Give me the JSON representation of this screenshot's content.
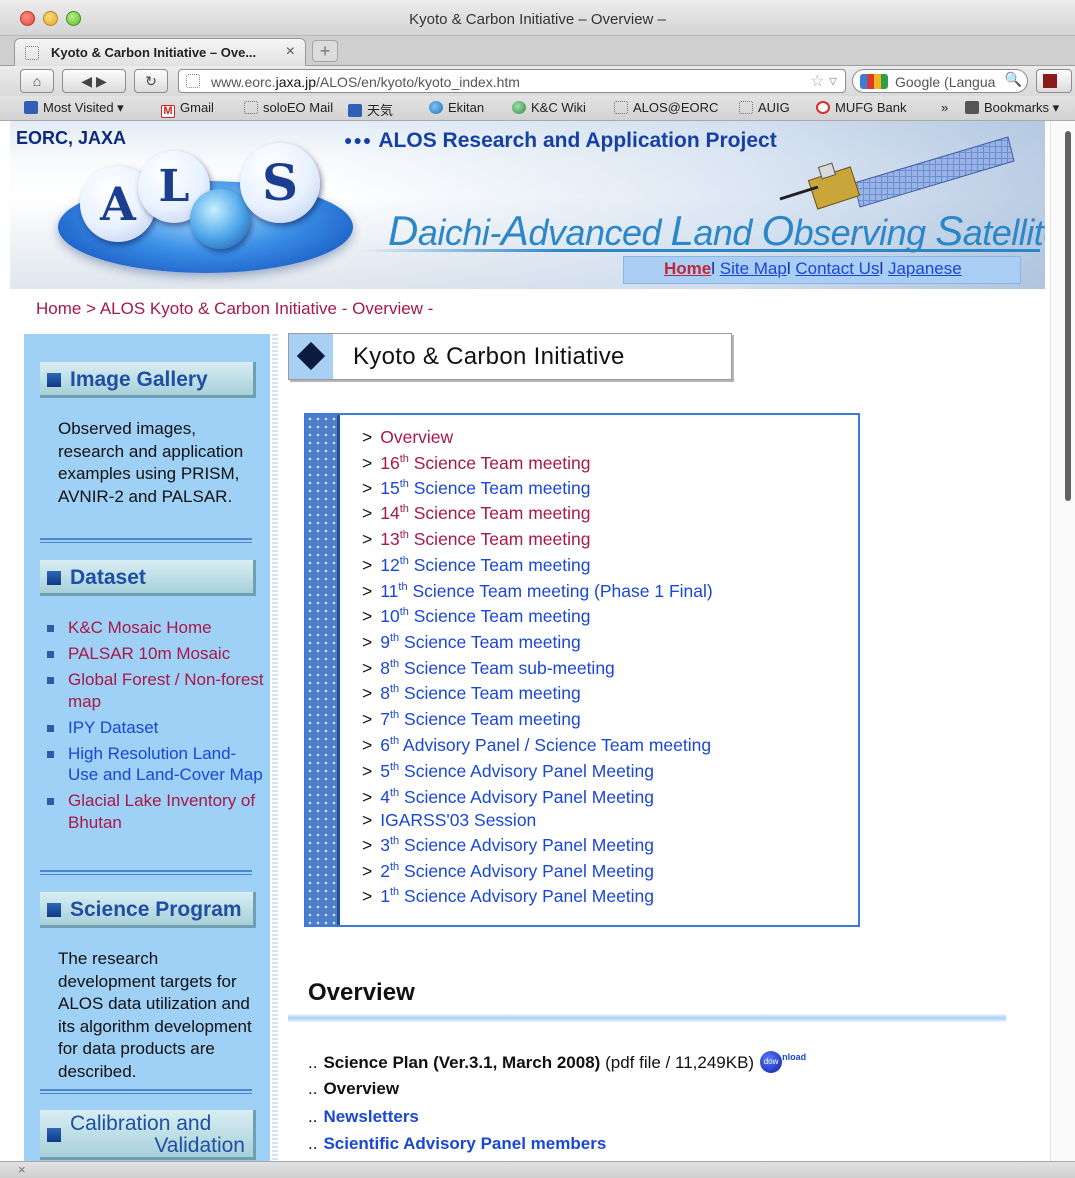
{
  "browser": {
    "window_title": "Kyoto & Carbon Initiative – Overview –",
    "tab_title": "Kyoto & Carbon Initiative – Ove...",
    "tab_close": "×",
    "new_tab": "+",
    "url_prefix": "www.eorc.",
    "url_domain": "jaxa.jp",
    "url_path": "/ALOS/en/kyoto/kyoto_index.htm",
    "search_placeholder": "Google (Langua",
    "bookmarks": [
      {
        "label": "Most Visited ▾",
        "icon": "most-visited-icon"
      },
      {
        "label": "Gmail",
        "icon": "gmail-icon"
      },
      {
        "label": "soloEO Mail",
        "icon": "page-icon"
      },
      {
        "label": "天気",
        "icon": "weather-icon"
      },
      {
        "label": "Ekitan",
        "icon": "globe-icon"
      },
      {
        "label": "K&C Wiki",
        "icon": "wiki-icon"
      },
      {
        "label": "ALOS@EORC",
        "icon": "page-icon"
      },
      {
        "label": "AUIG",
        "icon": "page-icon"
      },
      {
        "label": "MUFG Bank",
        "icon": "mufg-icon"
      },
      {
        "label": "»",
        "icon": "chevron-icon"
      },
      {
        "label": "Bookmarks ▾",
        "icon": "bookmarks-icon"
      }
    ]
  },
  "header": {
    "org": "EORC, JAXA",
    "logo_letters": [
      "A",
      "L",
      "S"
    ],
    "project_dots": "●●●",
    "project_title": "ALOS Research and Application Project",
    "tagline_parts": [
      "D",
      "aichi",
      "-",
      "A",
      "dvanced ",
      "L",
      "and ",
      "O",
      "bserving ",
      "S",
      "atellite"
    ],
    "nav": [
      {
        "label": "Home",
        "current": true
      },
      {
        "label": "Site Map",
        "current": false
      },
      {
        "label": "Contact Us",
        "current": false
      },
      {
        "label": "Japanese",
        "current": false
      }
    ],
    "nav_sep": "l"
  },
  "breadcrumb": {
    "home": "Home",
    "sep": ">",
    "current": "ALOS Kyoto & Carbon Initiative - Overview -"
  },
  "sidebar": {
    "image_gallery": {
      "title": "Image Gallery",
      "text": "Observed images, research and application examples using PRISM, AVNIR-2 and PALSAR."
    },
    "dataset": {
      "title": "Dataset",
      "items": [
        {
          "label": "K&C Mosaic Home",
          "visited": true
        },
        {
          "label": "PALSAR 10m Mosaic",
          "visited": true
        },
        {
          "label": "Global Forest / Non-forest map",
          "visited": true
        },
        {
          "label": "IPY Dataset",
          "visited": false
        },
        {
          "label": "High Resolution Land-Use and Land-Cover Map",
          "visited": false
        },
        {
          "label": "Glacial Lake Inventory of Bhutan",
          "visited": true
        }
      ]
    },
    "science_program": {
      "title": "Science Program",
      "text": "The research development targets for ALOS data utilization and its algorithm development for data products are described."
    },
    "calval": {
      "title_line1": "Calibration and",
      "title_line2": "Validation"
    }
  },
  "main": {
    "title": "Kyoto & Carbon Initiative",
    "meetings_sep": ">",
    "meetings": [
      {
        "num": "",
        "sup": "",
        "label": "Overview",
        "visited": true
      },
      {
        "num": "16",
        "sup": "th",
        "label": " Science Team meeting",
        "visited": true
      },
      {
        "num": "15",
        "sup": "th",
        "label": " Science Team meeting",
        "visited": false
      },
      {
        "num": "14",
        "sup": "th",
        "label": " Science Team meeting",
        "visited": true
      },
      {
        "num": "13",
        "sup": "th",
        "label": " Science Team meeting",
        "visited": true
      },
      {
        "num": "12",
        "sup": "th",
        "label": " Science Team meeting",
        "visited": false
      },
      {
        "num": "11",
        "sup": "th",
        "label": " Science Team meeting (Phase 1 Final)",
        "visited": false
      },
      {
        "num": "10",
        "sup": "th",
        "label": " Science Team meeting",
        "visited": false
      },
      {
        "num": "9",
        "sup": "th",
        "label": " Science Team meeting",
        "visited": false
      },
      {
        "num": "8",
        "sup": "th",
        "label": " Science Team sub-meeting",
        "visited": false
      },
      {
        "num": "8",
        "sup": "th",
        "label": " Science Team meeting",
        "visited": false
      },
      {
        "num": "7",
        "sup": "th",
        "label": " Science Team meeting",
        "visited": false
      },
      {
        "num": "6",
        "sup": "th",
        "label": " Advisory Panel / Science Team meeting",
        "visited": false
      },
      {
        "num": "5",
        "sup": "th",
        "label": " Science Advisory Panel Meeting",
        "visited": false
      },
      {
        "num": "4",
        "sup": "th",
        "label": " Science Advisory Panel Meeting",
        "visited": false
      },
      {
        "num": "",
        "sup": "",
        "label": "IGARSS'03 Session",
        "visited": false
      },
      {
        "num": "3",
        "sup": "th",
        "label": " Science Advisory Panel Meeting",
        "visited": false
      },
      {
        "num": "2",
        "sup": "th",
        "label": " Science Advisory Panel Meeting",
        "visited": false
      },
      {
        "num": "1",
        "sup": "th",
        "label": " Science Advisory Panel Meeting",
        "visited": false
      }
    ],
    "overview": {
      "heading": "Overview",
      "dots": "..",
      "science_plan_label": "Science Plan (Ver.3.1, March 2008)",
      "science_plan_meta": "(pdf file / 11,249KB)",
      "download_badge": "dow",
      "download_tail": "nload",
      "overview_label": "Overview",
      "newsletters_label": "Newsletters",
      "panel_label": "Scientific Advisory Panel members"
    }
  },
  "colors": {
    "link": "#1947d6",
    "visited": "#a8184a",
    "sidebar_bg": "#9fd0f6"
  }
}
